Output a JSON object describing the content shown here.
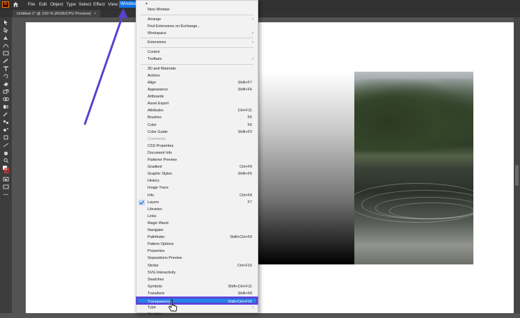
{
  "app": {
    "logo_text": "Ai"
  },
  "menubar": {
    "items": [
      "File",
      "Edit",
      "Object",
      "Type",
      "Select",
      "Effect",
      "View",
      "Window"
    ],
    "active": "Window"
  },
  "document_tab": {
    "title": "Untitled-1* @ 100 % (RGB/CPU Preview)",
    "close": "×"
  },
  "window_menu": {
    "groups": [
      [
        {
          "label": "New Window"
        }
      ],
      [
        {
          "label": "Arrange",
          "submenu": true
        },
        {
          "label": "Find Extensions on Exchange..."
        },
        {
          "label": "Workspace",
          "submenu": true
        }
      ],
      [
        {
          "label": "Extensions",
          "submenu": true
        }
      ],
      [
        {
          "label": "Control"
        },
        {
          "label": "Toolbars",
          "submenu": true
        }
      ],
      [
        {
          "label": "3D and Materials"
        },
        {
          "label": "Actions"
        },
        {
          "label": "Align",
          "shortcut": "Shift+F7"
        },
        {
          "label": "Appearance",
          "shortcut": "Shift+F6"
        },
        {
          "label": "Artboards"
        },
        {
          "label": "Asset Export"
        },
        {
          "label": "Attributes",
          "shortcut": "Ctrl+F11"
        },
        {
          "label": "Brushes",
          "shortcut": "F5"
        },
        {
          "label": "Color",
          "shortcut": "F6"
        },
        {
          "label": "Color Guide",
          "shortcut": "Shift+F3"
        },
        {
          "label": "Comments",
          "disabled": true
        },
        {
          "label": "CSS Properties"
        },
        {
          "label": "Document Info"
        },
        {
          "label": "Flattener Preview"
        },
        {
          "label": "Gradient",
          "shortcut": "Ctrl+F9"
        },
        {
          "label": "Graphic Styles",
          "shortcut": "Shift+F5"
        },
        {
          "label": "History"
        },
        {
          "label": "Image Trace"
        },
        {
          "label": "Info",
          "shortcut": "Ctrl+F8"
        },
        {
          "label": "Layers",
          "shortcut": "F7",
          "checked": true
        },
        {
          "label": "Libraries"
        },
        {
          "label": "Links"
        },
        {
          "label": "Magic Wand"
        },
        {
          "label": "Navigator"
        },
        {
          "label": "Pathfinder",
          "shortcut": "Shift+Ctrl+F9"
        },
        {
          "label": "Pattern Options"
        },
        {
          "label": "Properties"
        },
        {
          "label": "Separations Preview"
        },
        {
          "label": "Stroke",
          "shortcut": "Ctrl+F10"
        },
        {
          "label": "SVG Interactivity"
        },
        {
          "label": "Swatches"
        },
        {
          "label": "Symbols",
          "shortcut": "Shift+Ctrl+F11"
        },
        {
          "label": "Transform",
          "shortcut": "Shift+F8"
        },
        {
          "label": "Transparency",
          "shortcut": "Shift+Ctrl+F10",
          "highlighted": true
        },
        {
          "label": "Type",
          "submenu": true
        },
        {
          "label": "Variables",
          "partial": true
        }
      ]
    ]
  },
  "colors": {
    "accent": "#1473e6",
    "highlight": "#2680eb",
    "annotation": "#5b3fcf"
  },
  "icons": [
    "home-icon",
    "selection-tool-icon",
    "direct-selection-tool-icon",
    "pen-tool-icon",
    "curvature-tool-icon",
    "rectangle-tool-icon",
    "paintbrush-tool-icon",
    "type-tool-icon",
    "rotate-tool-icon",
    "eraser-tool-icon",
    "scale-tool-icon",
    "shape-builder-tool-icon",
    "gradient-tool-icon",
    "eyedropper-tool-icon",
    "blend-tool-icon",
    "symbol-sprayer-tool-icon",
    "artboard-tool-icon",
    "slice-tool-icon",
    "hand-tool-icon",
    "zoom-tool-icon",
    "fill-stroke-icon",
    "swap-icon",
    "draw-mode-icon",
    "screen-mode-icon",
    "more-tools-icon",
    "checkmark-icon",
    "submenu-arrow-icon",
    "pointer-cursor-icon"
  ]
}
